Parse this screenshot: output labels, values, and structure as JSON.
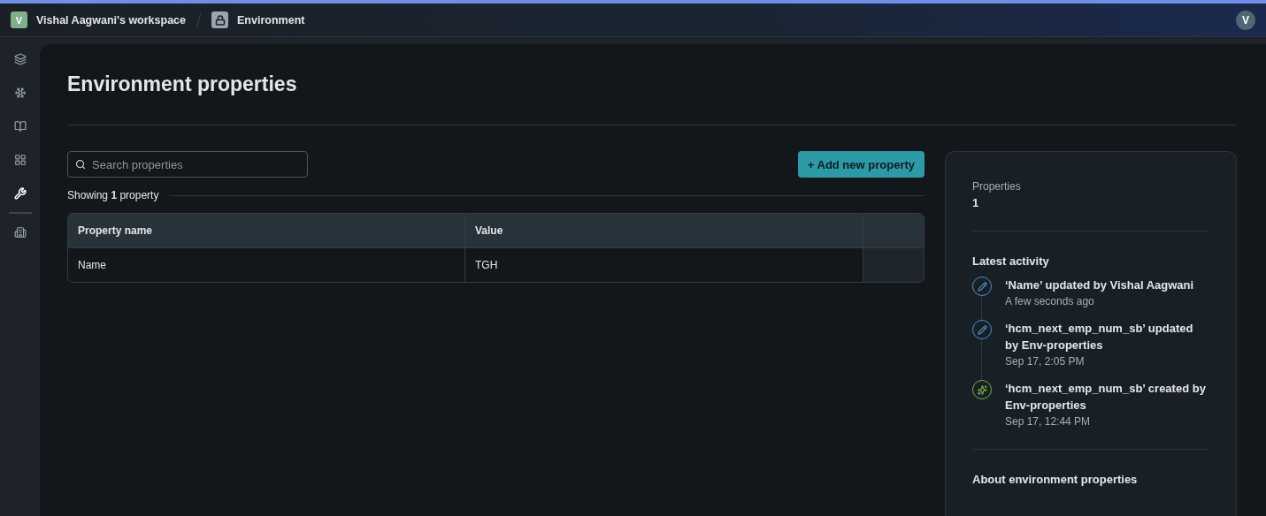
{
  "breadcrumb": {
    "workspace_initial": "V",
    "workspace": "Vishal Aagwani's workspace",
    "environment": "Environment"
  },
  "avatar": "V",
  "sidebar": {
    "items": [
      {
        "kind": "layers",
        "selected": false
      },
      {
        "kind": "snowflake",
        "selected": false
      },
      {
        "kind": "book",
        "selected": false
      },
      {
        "kind": "grid",
        "selected": false
      },
      {
        "kind": "wrench",
        "selected": true
      },
      {
        "kind": "building",
        "selected": false
      }
    ]
  },
  "title": "Environment properties",
  "search": {
    "placeholder": "Search properties"
  },
  "add_button": "+ Add new property",
  "showing": "Showing **1** property",
  "table": {
    "columns": [
      "Property name",
      "Value"
    ],
    "rows": [
      [
        "Name",
        "TGH"
      ]
    ]
  },
  "summary": {
    "label": "Properties",
    "count": "1"
  },
  "activity": {
    "title": "Latest activity",
    "items": [
      {
        "kind": "updated",
        "text": "‘Name’ updated by Vishal Aagwani",
        "time": "A few seconds ago"
      },
      {
        "kind": "updated",
        "text": "‘hcm_next_emp_num_sb’ updated by Env-properties",
        "time": "Sep 17, 2:05 PM"
      },
      {
        "kind": "created",
        "text": "‘hcm_next_emp_num_sb’ created by Env-properties",
        "time": "Sep 17, 12:44 PM"
      }
    ]
  },
  "about_title": "About environment properties"
}
